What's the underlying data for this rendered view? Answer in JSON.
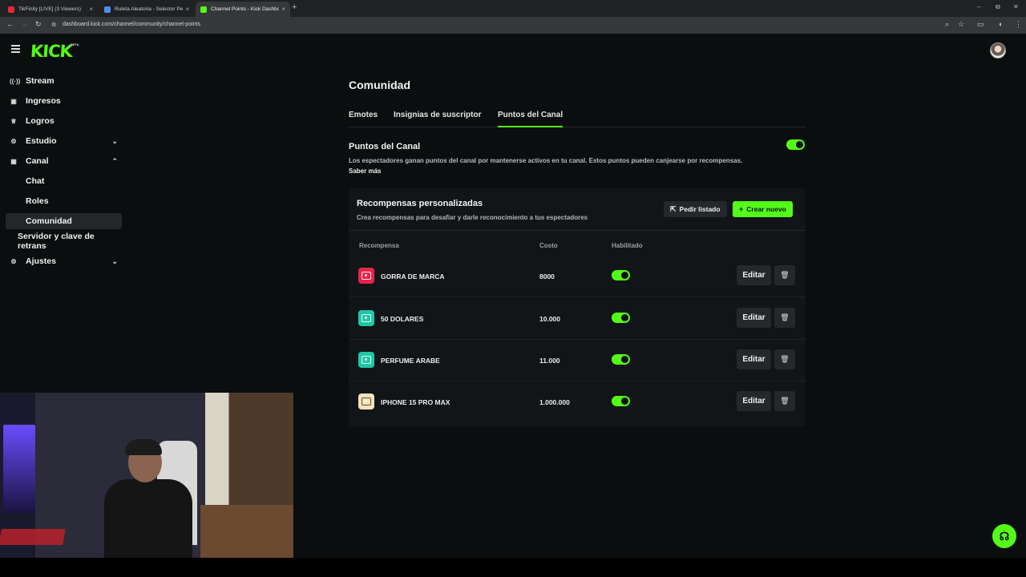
{
  "browser": {
    "tabs": [
      {
        "title": "TikFinity [LIVE] (3 Viewers)",
        "color": "#e8283a"
      },
      {
        "title": "Ruleta Aleatoria - Selector Pers...",
        "color": "#4a8df8"
      },
      {
        "title": "Channel Points - Kick Dashboard",
        "color": "#53fc18"
      }
    ],
    "url": "dashboard.kick.com/channel/community/channel-points"
  },
  "brand": {
    "logo": "KICK",
    "beta": "BETA",
    "accent": "#53fc18"
  },
  "sidebar": {
    "items": [
      {
        "label": "Stream",
        "icon": "broadcast-icon",
        "glyph": "((·))"
      },
      {
        "label": "Ingresos",
        "icon": "wallet-icon",
        "glyph": "▣"
      },
      {
        "label": "Logros",
        "icon": "trophy-icon",
        "glyph": "♕"
      },
      {
        "label": "Estudio",
        "icon": "studio-icon",
        "glyph": "⚙"
      },
      {
        "label": "Canal",
        "icon": "channel-icon",
        "glyph": "▦"
      },
      {
        "label": "Chat"
      },
      {
        "label": "Roles"
      },
      {
        "label": "Comunidad"
      },
      {
        "label": "Servidor y clave de retrans"
      },
      {
        "label": "Ajustes",
        "icon": "settings-icon",
        "glyph": "⚙"
      }
    ]
  },
  "main": {
    "title": "Comunidad",
    "tabs": [
      "Emotes",
      "Insignias de suscriptor",
      "Puntos del Canal"
    ],
    "section_title": "Puntos del Canal",
    "section_desc": "Los espectadores ganan puntos del canal por mantenerse activos en tu canal. Estos puntos pueden canjearse por recompensas.",
    "learn_more": "Saber más",
    "section_enabled": true
  },
  "rewards": {
    "title": "Recompensas personalizadas",
    "subtitle": "Crea recompensas para desafiar y darle reconocimiento a tus espectadores",
    "btn_list": "Pedir listado",
    "btn_create": "Crear nuevo",
    "columns": [
      "Recompensa",
      "Costo",
      "Habilitado"
    ],
    "edit_label": "Editar",
    "rows": [
      {
        "name": "GORRA DE MARCA",
        "cost": "8000",
        "enabled": true,
        "color": "#e8234a"
      },
      {
        "name": "50 DOLARES",
        "cost": "10.000",
        "enabled": true,
        "color": "#1fc7a6"
      },
      {
        "name": "PERFUME ARABE",
        "cost": "11.000",
        "enabled": true,
        "color": "#1fc7a6"
      },
      {
        "name": "IPHONE 15 PRO MAX",
        "cost": "1.000.000",
        "enabled": true,
        "color": "#f4e3b8"
      }
    ]
  }
}
